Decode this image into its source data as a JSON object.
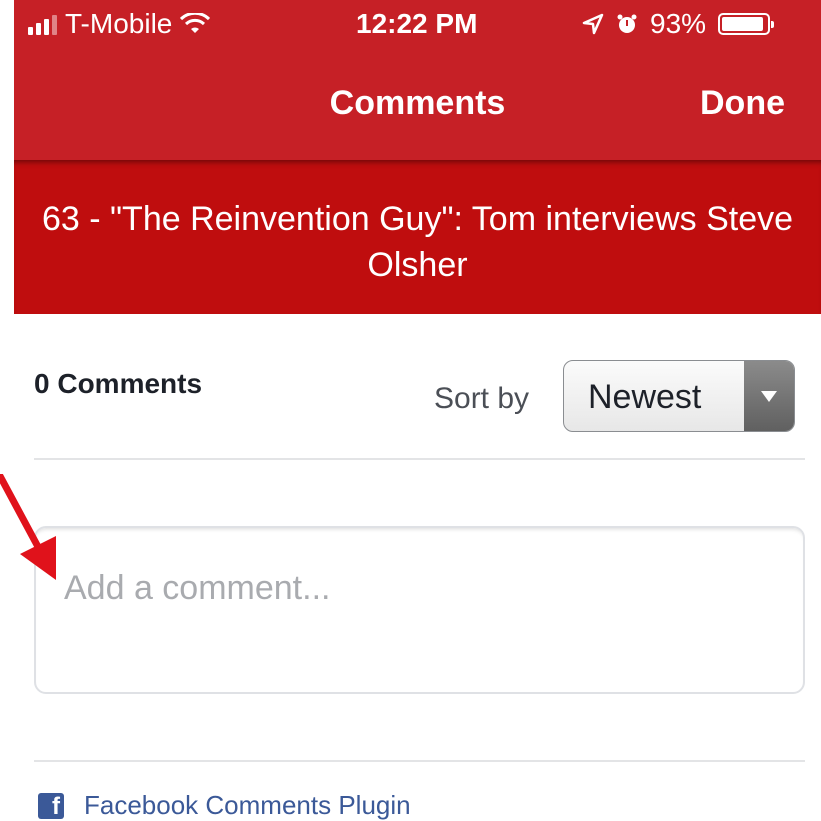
{
  "status_bar": {
    "carrier": "T-Mobile",
    "time": "12:22 PM",
    "battery": "93%",
    "icons": [
      "signal-bars-icon",
      "wifi-icon",
      "moon-icon",
      "location-arrow-icon",
      "alarm-icon",
      "battery-icon"
    ]
  },
  "nav": {
    "title": "Comments",
    "done_label": "Done"
  },
  "banner": {
    "title": "63 - \"The Reinvention Guy\": Tom interviews Steve Olsher"
  },
  "comments": {
    "count_label": "0 Comments",
    "sort_label": "Sort by",
    "sort_value": "Newest",
    "input_placeholder": "Add a comment...",
    "input_value": ""
  },
  "footer": {
    "plugin_label": "Facebook Comments Plugin",
    "logo_letter": "f"
  },
  "colors": {
    "header_red": "#c62026",
    "banner_red": "#bf0d0e",
    "annotation_arrow": "#e0121b",
    "facebook_blue": "#3b5998"
  }
}
